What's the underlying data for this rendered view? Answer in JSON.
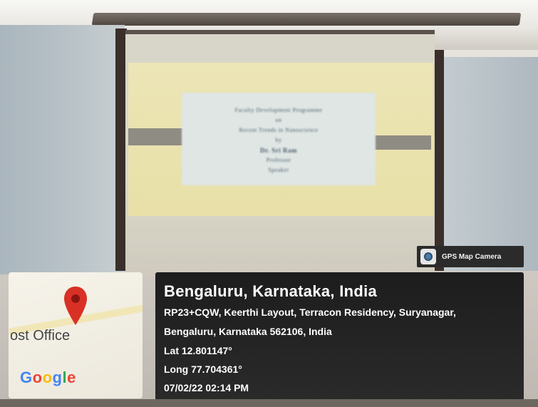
{
  "overlay": {
    "app_badge": "GPS Map Camera",
    "location_title": "Bengaluru, Karnataka, India",
    "address_line1": "RP23+CQW, Keerthi Layout, Terracon Residency, Suryanagar,",
    "address_line2": "Bengaluru, Karnataka 562106, India",
    "latitude": "Lat 12.801147°",
    "longitude": "Long 77.704361°",
    "datetime": "07/02/22 02:14 PM"
  },
  "map": {
    "label": "ost Office",
    "logo_text": "Google",
    "pin_color": "#d93025"
  },
  "slide": {
    "line1": "Faculty Development Programme",
    "line2": "on",
    "line3": "Recent Trends in Nanoscience",
    "line4": "by",
    "line5": "Dr. Sri Ram",
    "line6": "Professor",
    "line7": "Speaker"
  }
}
